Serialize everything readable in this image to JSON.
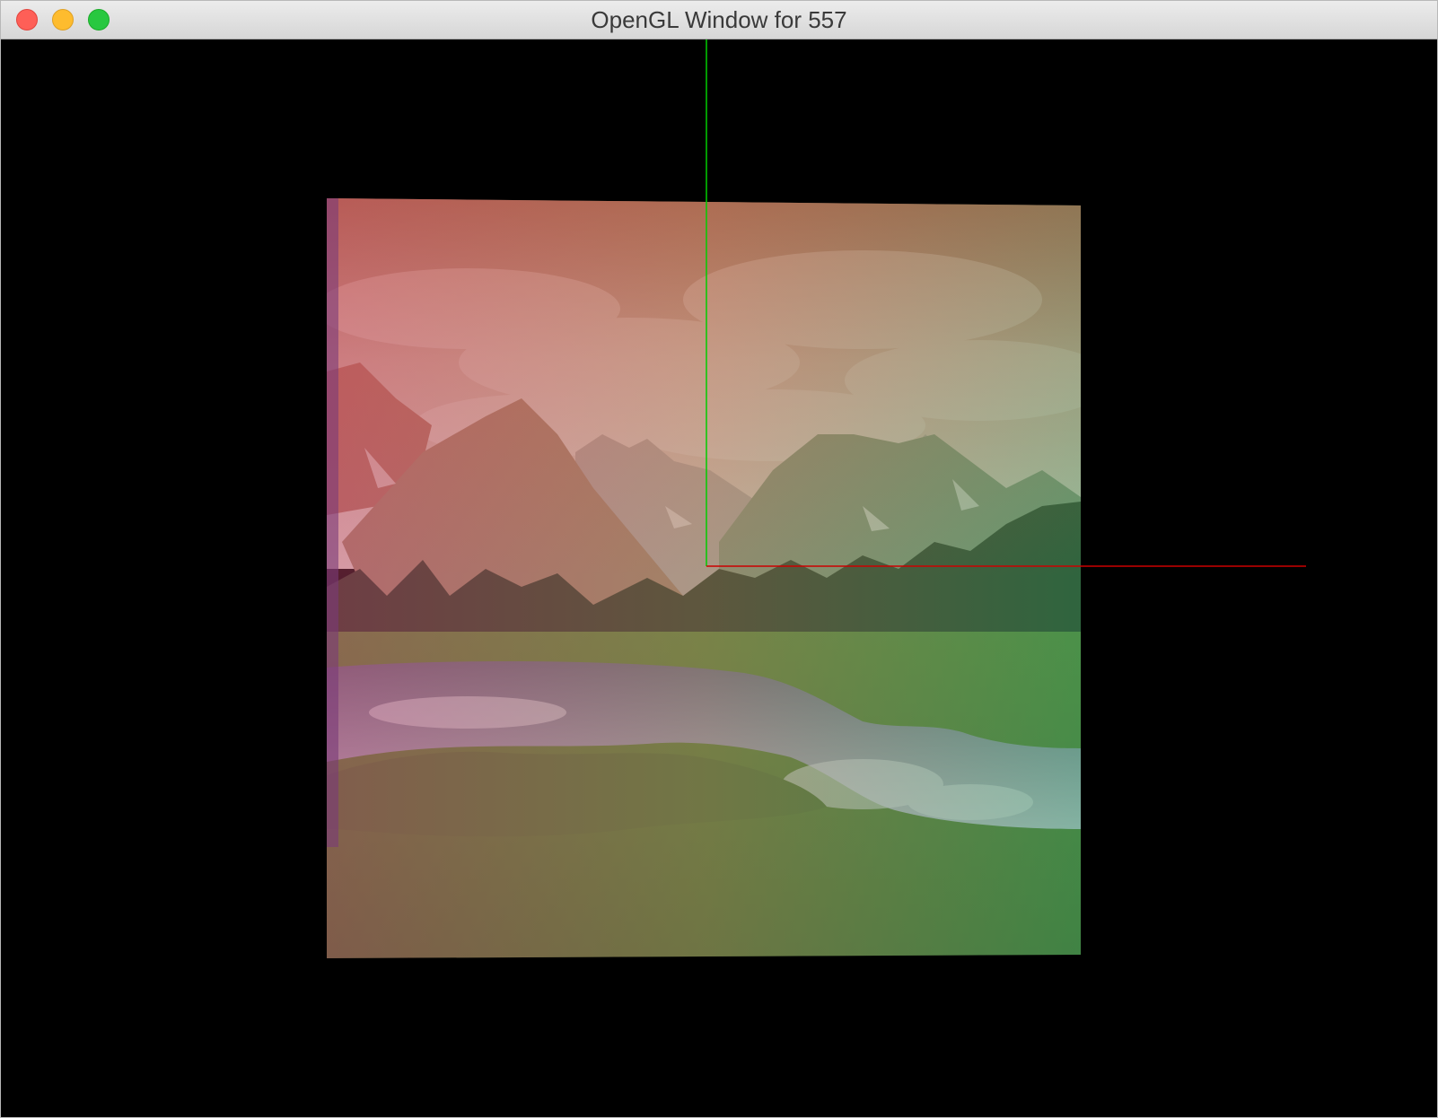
{
  "window": {
    "title": "OpenGL Window for 557",
    "background_color": "#000000"
  },
  "controls": {
    "close_color": "#fe5f57",
    "minimize_color": "#febc2e",
    "zoom_color": "#28c840"
  },
  "scene": {
    "texture": "mountain-lake-landscape",
    "tint_left": "#c0406a",
    "tint_right": "#2f9a5c",
    "x_axis_color": "#cc0000",
    "y_axis_color": "#00cc00"
  }
}
